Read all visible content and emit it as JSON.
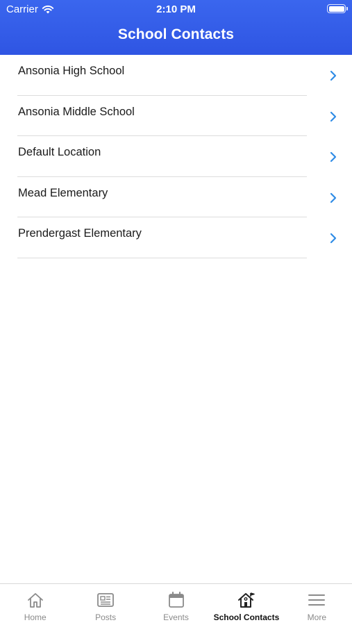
{
  "status_bar": {
    "carrier": "Carrier",
    "time": "2:10 PM"
  },
  "header": {
    "title": "School Contacts",
    "background_color": "#3460e9"
  },
  "schools": [
    {
      "label": "Ansonia High School"
    },
    {
      "label": "Ansonia Middle School"
    },
    {
      "label": "Default Location"
    },
    {
      "label": "Mead Elementary"
    },
    {
      "label": "Prendergast Elementary"
    }
  ],
  "chevron_color": "#2f8ce6",
  "tab_bar": {
    "tabs": [
      {
        "label": "Home",
        "icon": "home-icon"
      },
      {
        "label": "Posts",
        "icon": "newspaper-icon"
      },
      {
        "label": "Events",
        "icon": "calendar-icon"
      },
      {
        "label": "School Contacts",
        "icon": "school-house-icon",
        "active": true
      },
      {
        "label": "More",
        "icon": "menu-icon"
      }
    ]
  }
}
